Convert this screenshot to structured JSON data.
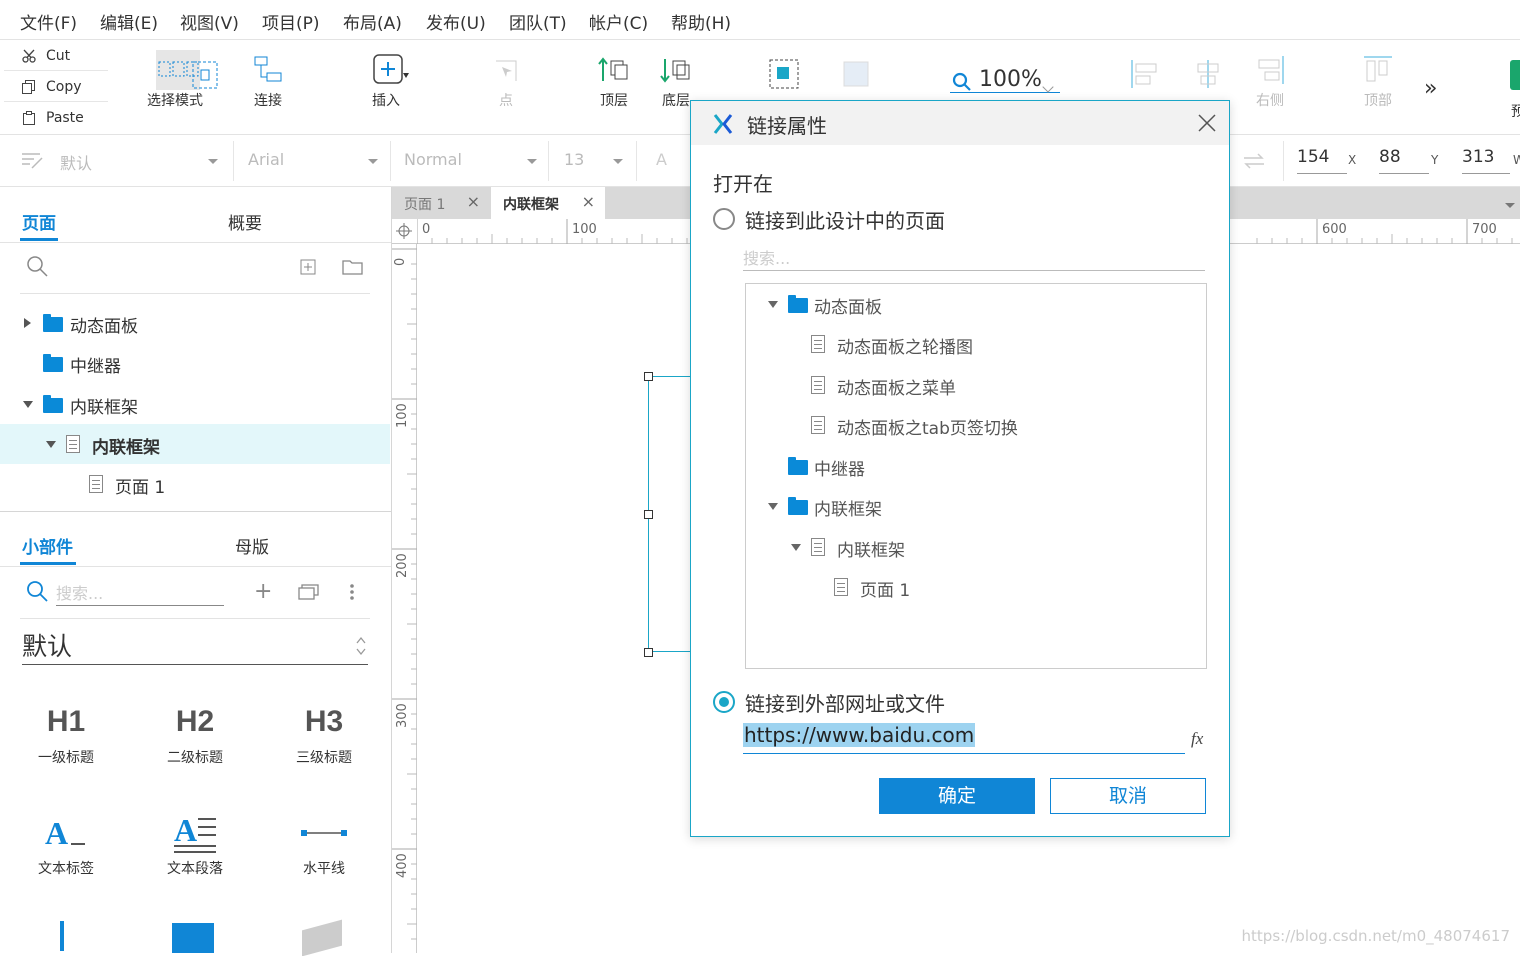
{
  "menu": [
    "文件(F)",
    "编辑(E)",
    "视图(V)",
    "项目(P)",
    "布局(A)",
    "发布(U)",
    "团队(T)",
    "帐户(C)",
    "帮助(H)"
  ],
  "clipboard": {
    "cut": "Cut",
    "copy": "Copy",
    "paste": "Paste"
  },
  "toolbar": {
    "select_mode": "选择模式",
    "connect": "连接",
    "insert": "插入",
    "point": "点",
    "top_layer": "顶层",
    "bottom_layer": "底层",
    "zoom": "100%",
    "right": "右侧",
    "top": "顶部",
    "more": "预"
  },
  "format": {
    "style": "默认",
    "font": "Arial",
    "weight": "Normal",
    "size": "13",
    "x": "154",
    "x_label": "X",
    "y": "88",
    "y_label": "Y",
    "w": "313",
    "w_label": "W"
  },
  "pages_panel": {
    "tab_pages": "页面",
    "tab_outline": "概要",
    "tree": [
      {
        "label": "动态面板",
        "type": "folder",
        "expanded": false
      },
      {
        "label": "中继器",
        "type": "folder"
      },
      {
        "label": "内联框架",
        "type": "folder",
        "expanded": true
      },
      {
        "label": "内联框架",
        "type": "page",
        "selected": true,
        "expanded": true
      },
      {
        "label": "页面 1",
        "type": "page"
      }
    ]
  },
  "widgets_panel": {
    "tab_widgets": "小部件",
    "tab_masters": "母版",
    "search_placeholder": "搜索...",
    "library": "默认",
    "items": [
      {
        "icon": "H1",
        "label": "一级标题"
      },
      {
        "icon": "H2",
        "label": "二级标题"
      },
      {
        "icon": "H3",
        "label": "三级标题"
      },
      {
        "icon": "A_",
        "label": "文本标签"
      },
      {
        "icon": "A≡",
        "label": "文本段落"
      },
      {
        "icon": "line",
        "label": "水平线"
      }
    ]
  },
  "canvas": {
    "tabs": [
      "页面 1",
      "内联框架"
    ],
    "ruler_h": [
      "0",
      "100",
      "600",
      "700"
    ],
    "ruler_v": [
      "0",
      "100",
      "200",
      "300",
      "400"
    ]
  },
  "dialog": {
    "title": "链接属性",
    "section": "打开在",
    "option_page": "链接到此设计中的页面",
    "search_placeholder": "搜索...",
    "tree": [
      {
        "label": "动态面板",
        "type": "folder",
        "level": 0,
        "expanded": true
      },
      {
        "label": "动态面板之轮播图",
        "type": "page",
        "level": 1
      },
      {
        "label": "动态面板之菜单",
        "type": "page",
        "level": 1
      },
      {
        "label": "动态面板之tab页签切换",
        "type": "page",
        "level": 1
      },
      {
        "label": "中继器",
        "type": "folder",
        "level": 0
      },
      {
        "label": "内联框架",
        "type": "folder",
        "level": 0,
        "expanded": true
      },
      {
        "label": "内联框架",
        "type": "page",
        "level": 1,
        "expanded": true
      },
      {
        "label": "页面 1",
        "type": "page",
        "level": 2
      }
    ],
    "option_url": "链接到外部网址或文件",
    "url_value": "https://www.baidu.com",
    "fx": "fx",
    "ok": "确定",
    "cancel": "取消"
  },
  "watermark": "https://blog.csdn.net/m0_48074617",
  "colors": {
    "accent": "#1086d6",
    "teal": "#1aa6c7",
    "folder": "#0a8ad8",
    "selected_row": "#e3f7fa"
  }
}
